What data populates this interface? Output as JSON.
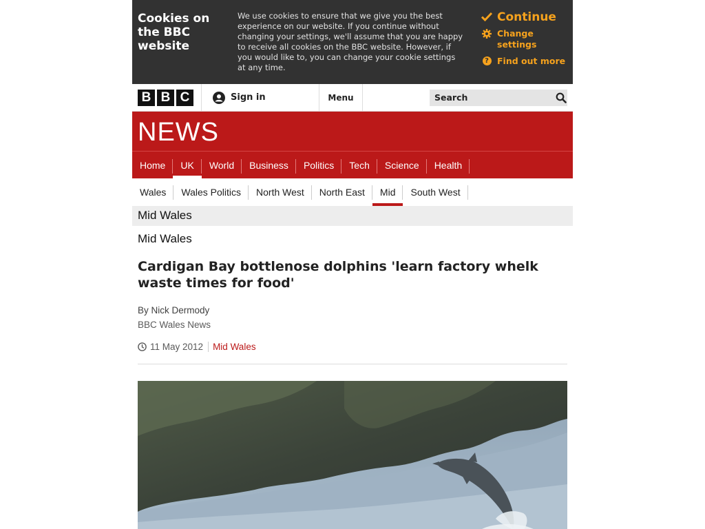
{
  "cookie_banner": {
    "title": "Cookies on the BBC website",
    "text": "We use cookies to ensure that we give you the best experience on our website.   If you continue without changing your settings, we'll assume that you are happy to receive all cookies on the BBC website. However, if you would like to, you can change your cookie settings at any time.",
    "continue_label": "Continue",
    "change_settings_label": "Change settings",
    "find_out_more_label": "Find out more",
    "accent_color": "#f6a21d"
  },
  "masthead": {
    "logo_letters": [
      "B",
      "B",
      "C"
    ],
    "sign_in_label": "Sign in",
    "menu_label": "Menu",
    "search_placeholder": "Search"
  },
  "news_banner": {
    "logo_text": "NEWS",
    "color": "#bb1919"
  },
  "primary_nav": {
    "items": [
      {
        "label": "Home"
      },
      {
        "label": "UK"
      },
      {
        "label": "World"
      },
      {
        "label": "Business"
      },
      {
        "label": "Politics"
      },
      {
        "label": "Tech"
      },
      {
        "label": "Science"
      },
      {
        "label": "Health"
      }
    ],
    "active": "UK"
  },
  "secondary_nav": {
    "items": [
      {
        "label": "Wales"
      },
      {
        "label": "Wales Politics"
      },
      {
        "label": "North West"
      },
      {
        "label": "North East"
      },
      {
        "label": "Mid"
      },
      {
        "label": "South West"
      }
    ],
    "active": "Mid"
  },
  "section": {
    "title": "Mid Wales"
  },
  "article": {
    "section_label": "Mid Wales",
    "headline": "Cardigan Bay bottlenose dolphins 'learn factory whelk waste times for food'",
    "author": "By Nick Dermody",
    "organisation": "BBC Wales News",
    "date": "11 May 2012",
    "topic_link": "Mid Wales"
  }
}
